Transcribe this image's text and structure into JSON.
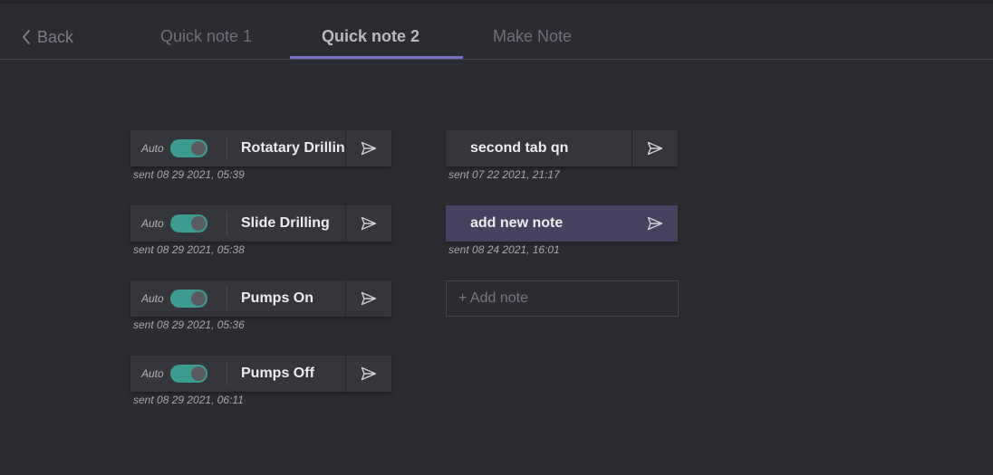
{
  "nav": {
    "back_label": "Back",
    "tabs": [
      {
        "label": "Quick note 1",
        "active": false
      },
      {
        "label": "Quick note 2",
        "active": true
      },
      {
        "label": "Make Note",
        "active": false
      }
    ]
  },
  "left_notes": [
    {
      "auto_label": "Auto",
      "auto_on": true,
      "title": "Rotatary Drilling",
      "sent": "sent 08 29 2021, 05:39"
    },
    {
      "auto_label": "Auto",
      "auto_on": true,
      "title": "Slide Drilling",
      "sent": "sent 08 29 2021, 05:38"
    },
    {
      "auto_label": "Auto",
      "auto_on": true,
      "title": "Pumps On",
      "sent": "sent 08 29 2021, 05:36"
    },
    {
      "auto_label": "Auto",
      "auto_on": true,
      "title": "Pumps Off",
      "sent": "sent 08 29 2021, 06:11"
    }
  ],
  "right_notes": [
    {
      "title": "second tab qn",
      "sent": "sent 07 22 2021, 21:17",
      "highlighted": false
    },
    {
      "title": "add new note",
      "sent": "sent 08 24 2021, 16:01",
      "highlighted": true
    }
  ],
  "add_note_label": "+ Add note",
  "colors": {
    "background": "#2b2c31",
    "card": "#35363c",
    "card_highlight": "#454260",
    "accent_underline": "#7a6fc9",
    "toggle_on": "#3b9c8f"
  }
}
